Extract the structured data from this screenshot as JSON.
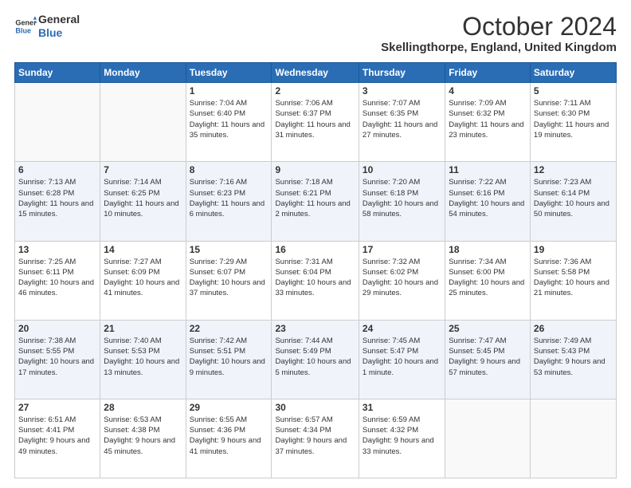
{
  "logo": {
    "line1": "General",
    "line2": "Blue"
  },
  "header": {
    "month": "October 2024",
    "location": "Skellingthorpe, England, United Kingdom"
  },
  "days_of_week": [
    "Sunday",
    "Monday",
    "Tuesday",
    "Wednesday",
    "Thursday",
    "Friday",
    "Saturday"
  ],
  "weeks": [
    [
      {
        "day": "",
        "info": ""
      },
      {
        "day": "",
        "info": ""
      },
      {
        "day": "1",
        "info": "Sunrise: 7:04 AM\nSunset: 6:40 PM\nDaylight: 11 hours and 35 minutes."
      },
      {
        "day": "2",
        "info": "Sunrise: 7:06 AM\nSunset: 6:37 PM\nDaylight: 11 hours and 31 minutes."
      },
      {
        "day": "3",
        "info": "Sunrise: 7:07 AM\nSunset: 6:35 PM\nDaylight: 11 hours and 27 minutes."
      },
      {
        "day": "4",
        "info": "Sunrise: 7:09 AM\nSunset: 6:32 PM\nDaylight: 11 hours and 23 minutes."
      },
      {
        "day": "5",
        "info": "Sunrise: 7:11 AM\nSunset: 6:30 PM\nDaylight: 11 hours and 19 minutes."
      }
    ],
    [
      {
        "day": "6",
        "info": "Sunrise: 7:13 AM\nSunset: 6:28 PM\nDaylight: 11 hours and 15 minutes."
      },
      {
        "day": "7",
        "info": "Sunrise: 7:14 AM\nSunset: 6:25 PM\nDaylight: 11 hours and 10 minutes."
      },
      {
        "day": "8",
        "info": "Sunrise: 7:16 AM\nSunset: 6:23 PM\nDaylight: 11 hours and 6 minutes."
      },
      {
        "day": "9",
        "info": "Sunrise: 7:18 AM\nSunset: 6:21 PM\nDaylight: 11 hours and 2 minutes."
      },
      {
        "day": "10",
        "info": "Sunrise: 7:20 AM\nSunset: 6:18 PM\nDaylight: 10 hours and 58 minutes."
      },
      {
        "day": "11",
        "info": "Sunrise: 7:22 AM\nSunset: 6:16 PM\nDaylight: 10 hours and 54 minutes."
      },
      {
        "day": "12",
        "info": "Sunrise: 7:23 AM\nSunset: 6:14 PM\nDaylight: 10 hours and 50 minutes."
      }
    ],
    [
      {
        "day": "13",
        "info": "Sunrise: 7:25 AM\nSunset: 6:11 PM\nDaylight: 10 hours and 46 minutes."
      },
      {
        "day": "14",
        "info": "Sunrise: 7:27 AM\nSunset: 6:09 PM\nDaylight: 10 hours and 41 minutes."
      },
      {
        "day": "15",
        "info": "Sunrise: 7:29 AM\nSunset: 6:07 PM\nDaylight: 10 hours and 37 minutes."
      },
      {
        "day": "16",
        "info": "Sunrise: 7:31 AM\nSunset: 6:04 PM\nDaylight: 10 hours and 33 minutes."
      },
      {
        "day": "17",
        "info": "Sunrise: 7:32 AM\nSunset: 6:02 PM\nDaylight: 10 hours and 29 minutes."
      },
      {
        "day": "18",
        "info": "Sunrise: 7:34 AM\nSunset: 6:00 PM\nDaylight: 10 hours and 25 minutes."
      },
      {
        "day": "19",
        "info": "Sunrise: 7:36 AM\nSunset: 5:58 PM\nDaylight: 10 hours and 21 minutes."
      }
    ],
    [
      {
        "day": "20",
        "info": "Sunrise: 7:38 AM\nSunset: 5:55 PM\nDaylight: 10 hours and 17 minutes."
      },
      {
        "day": "21",
        "info": "Sunrise: 7:40 AM\nSunset: 5:53 PM\nDaylight: 10 hours and 13 minutes."
      },
      {
        "day": "22",
        "info": "Sunrise: 7:42 AM\nSunset: 5:51 PM\nDaylight: 10 hours and 9 minutes."
      },
      {
        "day": "23",
        "info": "Sunrise: 7:44 AM\nSunset: 5:49 PM\nDaylight: 10 hours and 5 minutes."
      },
      {
        "day": "24",
        "info": "Sunrise: 7:45 AM\nSunset: 5:47 PM\nDaylight: 10 hours and 1 minute."
      },
      {
        "day": "25",
        "info": "Sunrise: 7:47 AM\nSunset: 5:45 PM\nDaylight: 9 hours and 57 minutes."
      },
      {
        "day": "26",
        "info": "Sunrise: 7:49 AM\nSunset: 5:43 PM\nDaylight: 9 hours and 53 minutes."
      }
    ],
    [
      {
        "day": "27",
        "info": "Sunrise: 6:51 AM\nSunset: 4:41 PM\nDaylight: 9 hours and 49 minutes."
      },
      {
        "day": "28",
        "info": "Sunrise: 6:53 AM\nSunset: 4:38 PM\nDaylight: 9 hours and 45 minutes."
      },
      {
        "day": "29",
        "info": "Sunrise: 6:55 AM\nSunset: 4:36 PM\nDaylight: 9 hours and 41 minutes."
      },
      {
        "day": "30",
        "info": "Sunrise: 6:57 AM\nSunset: 4:34 PM\nDaylight: 9 hours and 37 minutes."
      },
      {
        "day": "31",
        "info": "Sunrise: 6:59 AM\nSunset: 4:32 PM\nDaylight: 9 hours and 33 minutes."
      },
      {
        "day": "",
        "info": ""
      },
      {
        "day": "",
        "info": ""
      }
    ]
  ]
}
